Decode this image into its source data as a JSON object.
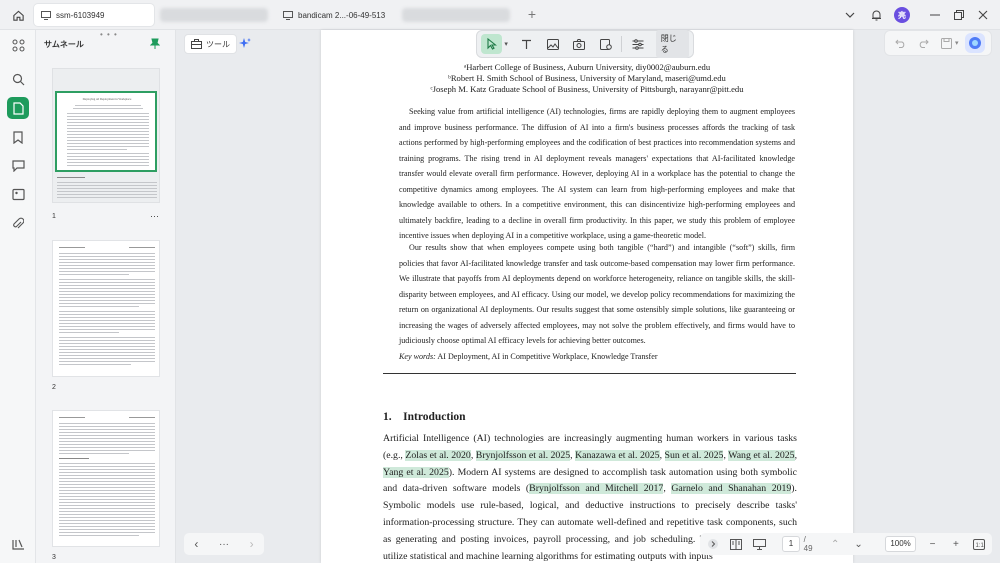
{
  "window": {
    "tabs": [
      {
        "label": "ssm-6103949",
        "active": true
      },
      {
        "label": "bandicam 2...-06-49-513",
        "active": false
      }
    ],
    "avatar_initial": "亮"
  },
  "sidebar": {
    "title": "サムネール",
    "thumbnails": [
      {
        "number": "1",
        "thumb_title": "Deploying AI Deployment in Workplace"
      },
      {
        "number": "2"
      },
      {
        "number": "3"
      }
    ]
  },
  "toolbar": {
    "tool_label": "ツール",
    "close_label": "閉じる"
  },
  "document": {
    "affiliations": [
      "ᵃHarbert College of Business, Auburn University, diy0002@auburn.edu",
      "ᵇRobert H. Smith School of Business, University of Maryland, maseri@umd.edu",
      "ᶜJoseph M. Katz Graduate School of Business, University of Pittsburgh, narayanr@pitt.edu"
    ],
    "abstract_p1": "Seeking value from artificial intelligence (AI) technologies, firms are rapidly deploying them to augment employees and improve business performance. The diffusion of AI into a firm's business processes affords the tracking of task actions performed by high-performing employees and the codification of best practices into recommendation systems and training programs. The rising trend in AI deployment reveals managers' expectations that AI-facilitated knowledge transfer would elevate overall firm performance. However, deploying AI in a workplace has the potential to change the competitive dynamics among employees. The AI system can learn from high-performing employees and make that knowledge available to others. In a competitive environment, this can disincentivize high-performing employees and ultimately backfire, leading to a decline in overall firm productivity. In this paper, we study this problem of employee incentive issues when deploying AI in a competitive workplace, using a game-theoretic model.",
    "abstract_p2": "Our results show that when employees compete using both tangible (“hard”) and intangible (“soft”) skills, firm policies that favor AI-facilitated knowledge transfer and task outcome-based compensation may lower firm performance. We illustrate that payoffs from AI deployments depend on workforce heterogeneity, reliance on tangible skills, the skill-disparity between employees, and AI efficacy. Using our model, we develop policy recommendations for maximizing the return on organizational AI deployments. Our results suggest that some ostensibly simple solutions, like guaranteeing or increasing the wages of adversely affected employees, may not solve the problem effectively, and firms would have to judiciously choose optimal AI efficacy levels for achieving better outcomes.",
    "keywords_label": "Key words:",
    "keywords": "AI Deployment, AI in Competitive Workplace, Knowledge Transfer",
    "section_title": "1. Introduction",
    "intro": {
      "t1": "Artificial Intelligence (AI) technologies are increasingly augmenting human workers in various tasks (e.g., ",
      "c1": "Zolas et al. 2020",
      "s1": ", ",
      "c2": "Brynjolfsson et al. 2025",
      "s2": ", ",
      "c3": "Kanazawa et al. 2025",
      "s3": ", ",
      "c4": "Sun et al. 2025",
      "s4": ", ",
      "c5": "Wang et al. 2025",
      "s5": ", ",
      "c6": "Yang et al. 2025",
      "t2": "). Modern AI systems are designed to accomplish task automation using both symbolic and data-driven software models (",
      "c7": "Brynjolfsson and Mitchell 2017",
      "s6": ", ",
      "c8": "Garnelo and Shanahan 2019",
      "t3": "). Symbolic models use rule-based, logical, and deductive instructions to precisely describe tasks' information-processing structure. They can automate well-defined and repetitive task components, such as generating and posting invoices, payroll processing, and job scheduling. The data-driven models utilize statistical and machine learning algorithms for estimating outputs with inputs"
    }
  },
  "navigation": {
    "page_current": "1",
    "page_total": "/ 49",
    "zoom": "100%"
  },
  "colors": {
    "accent": "#1e9b5c",
    "citation_highlight": "#cfe9da"
  }
}
